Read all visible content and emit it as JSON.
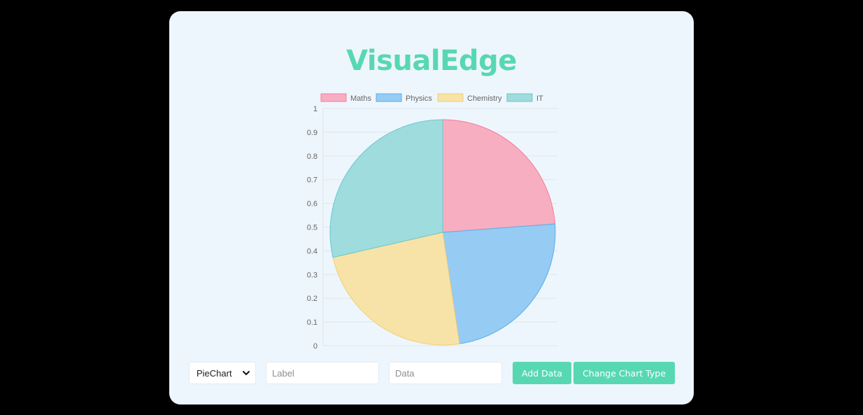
{
  "app": {
    "title": "VisualEdge"
  },
  "controls": {
    "chart_type_selected": "PieChart",
    "label_placeholder": "Label",
    "data_placeholder": "Data",
    "add_button": "Add Data",
    "change_button": "Change Chart Type"
  },
  "colors": {
    "accent": "#57d8b3",
    "card_background": "#eef6fd"
  },
  "chart_data": {
    "type": "pie",
    "categories": [
      "Maths",
      "Physics",
      "Chemistry",
      "IT"
    ],
    "values": [
      1,
      1,
      1,
      1.2
    ],
    "colors": {
      "fill": [
        "#f7aec1",
        "#96cbf4",
        "#f7e3a8",
        "#9edcde"
      ],
      "stroke": [
        "#f47e9a",
        "#5aaee6",
        "#f3cf70",
        "#6cc7cb"
      ]
    },
    "legend": "top",
    "grid": true,
    "ylim": [
      0,
      1
    ],
    "yticks": [
      "0",
      "0.1",
      "0.2",
      "0.3",
      "0.4",
      "0.5",
      "0.6",
      "0.7",
      "0.8",
      "0.9",
      "1"
    ]
  }
}
